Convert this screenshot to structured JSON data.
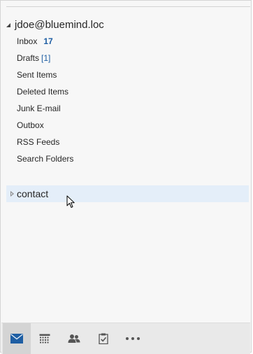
{
  "account": {
    "name": "jdoe@bluemind.loc"
  },
  "folders": [
    {
      "label": "Inbox",
      "count": "17"
    },
    {
      "label": "Drafts",
      "count": "[1]"
    },
    {
      "label": "Sent Items"
    },
    {
      "label": "Deleted Items"
    },
    {
      "label": "Junk E-mail"
    },
    {
      "label": "Outbox"
    },
    {
      "label": "RSS Feeds"
    },
    {
      "label": "Search Folders"
    }
  ],
  "group": {
    "label": "contact"
  },
  "navbar": {
    "items": [
      {
        "icon": "mail-icon",
        "active": true
      },
      {
        "icon": "calendar-icon",
        "active": false
      },
      {
        "icon": "people-icon",
        "active": false
      },
      {
        "icon": "tasks-icon",
        "active": false
      },
      {
        "icon": "more-icon",
        "active": false
      }
    ]
  },
  "colors": {
    "accent": "#1e5ea3",
    "hover_row": "#e4eef9",
    "pane_bg": "#f7f7f7",
    "navbar_bg": "#e9e9e9"
  }
}
